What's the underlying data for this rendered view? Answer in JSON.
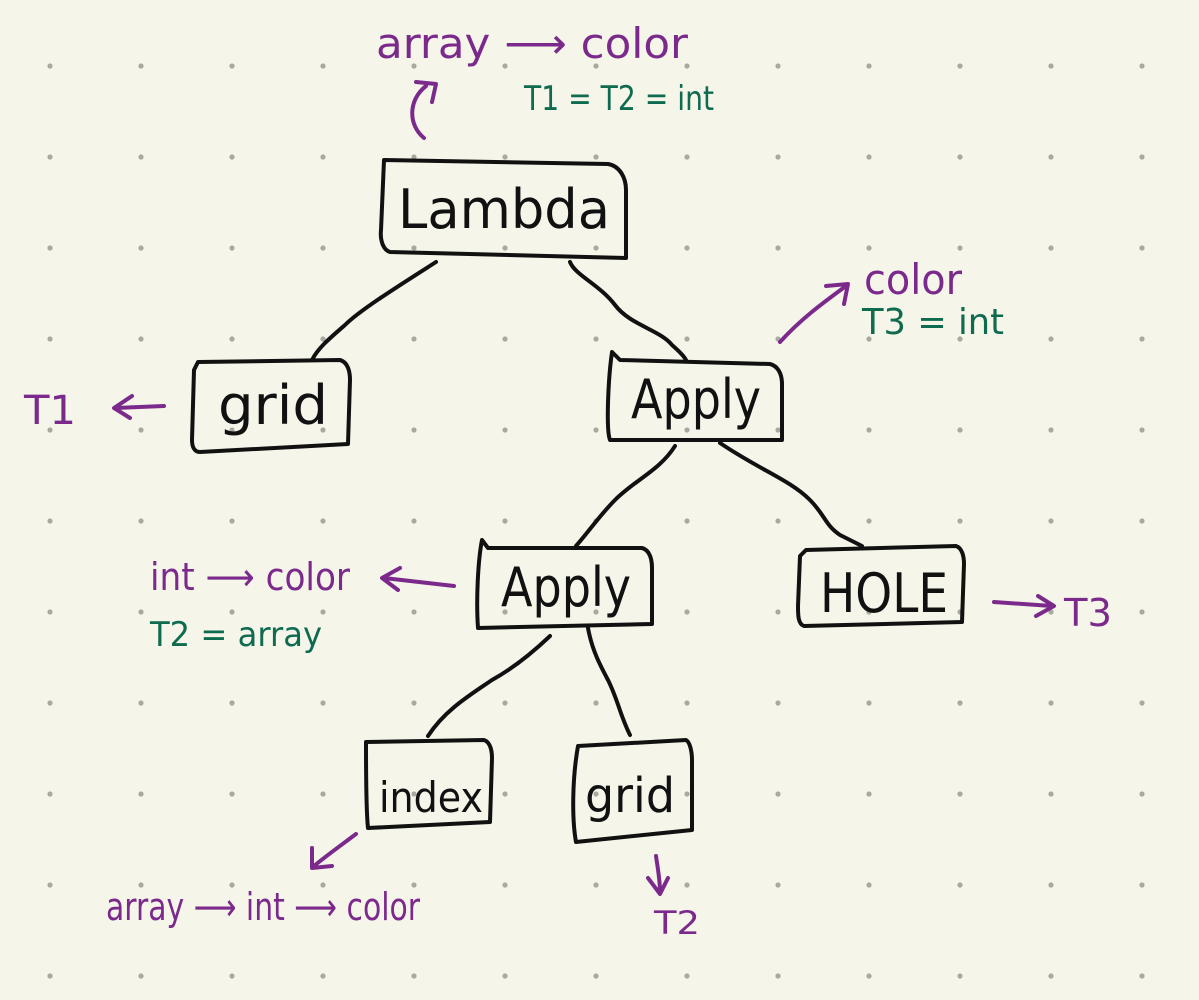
{
  "colors": {
    "background": "#f5f5ea",
    "ink": "#111111",
    "annotation_purple": "#7b2a8c",
    "annotation_green": "#0f6b4f"
  },
  "nodes": {
    "lambda": "Lambda",
    "grid_left": "grid",
    "apply_top": "Apply",
    "apply_mid": "Apply",
    "hole": "HOLE",
    "index": "index",
    "grid_bottom": "grid"
  },
  "annotations": {
    "lambda_type": "array ⟶ color",
    "lambda_constraint": "T1 = T2 = int",
    "grid_left_type": "T1",
    "apply_top_type": "color",
    "apply_top_constraint": "T3 = int",
    "apply_mid_type": "int ⟶ color",
    "apply_mid_constraint": "T2 = array",
    "hole_type": "T3",
    "index_type": "array ⟶ int ⟶ color",
    "grid_bottom_type": "T2"
  }
}
